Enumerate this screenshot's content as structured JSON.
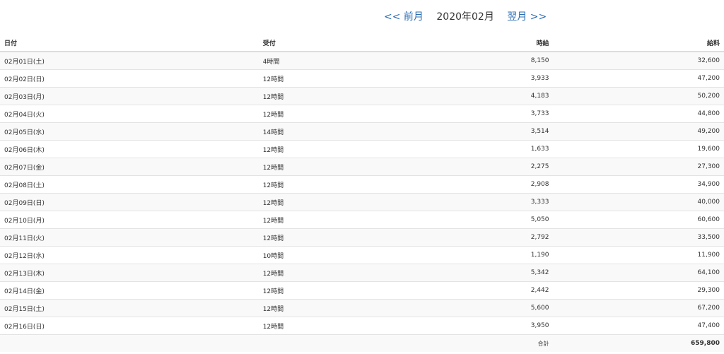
{
  "nav": {
    "prev_label": "<< 前月",
    "current_month": "2020年02月",
    "next_label": "翌月 >>"
  },
  "table": {
    "headers": {
      "date": "日付",
      "reception": "受付",
      "hourly": "時給",
      "pay": "給料"
    },
    "rows": [
      {
        "date": "02月01日(土)",
        "reception": "4時間",
        "hourly": "8,150",
        "pay": "32,600"
      },
      {
        "date": "02月02日(日)",
        "reception": "12時間",
        "hourly": "3,933",
        "pay": "47,200"
      },
      {
        "date": "02月03日(月)",
        "reception": "12時間",
        "hourly": "4,183",
        "pay": "50,200"
      },
      {
        "date": "02月04日(火)",
        "reception": "12時間",
        "hourly": "3,733",
        "pay": "44,800"
      },
      {
        "date": "02月05日(水)",
        "reception": "14時間",
        "hourly": "3,514",
        "pay": "49,200"
      },
      {
        "date": "02月06日(木)",
        "reception": "12時間",
        "hourly": "1,633",
        "pay": "19,600"
      },
      {
        "date": "02月07日(金)",
        "reception": "12時間",
        "hourly": "2,275",
        "pay": "27,300"
      },
      {
        "date": "02月08日(土)",
        "reception": "12時間",
        "hourly": "2,908",
        "pay": "34,900"
      },
      {
        "date": "02月09日(日)",
        "reception": "12時間",
        "hourly": "3,333",
        "pay": "40,000"
      },
      {
        "date": "02月10日(月)",
        "reception": "12時間",
        "hourly": "5,050",
        "pay": "60,600"
      },
      {
        "date": "02月11日(火)",
        "reception": "12時間",
        "hourly": "2,792",
        "pay": "33,500"
      },
      {
        "date": "02月12日(水)",
        "reception": "10時間",
        "hourly": "1,190",
        "pay": "11,900"
      },
      {
        "date": "02月13日(木)",
        "reception": "12時間",
        "hourly": "5,342",
        "pay": "64,100"
      },
      {
        "date": "02月14日(金)",
        "reception": "12時間",
        "hourly": "2,442",
        "pay": "29,300"
      },
      {
        "date": "02月15日(土)",
        "reception": "12時間",
        "hourly": "5,600",
        "pay": "67,200"
      },
      {
        "date": "02月16日(日)",
        "reception": "12時間",
        "hourly": "3,950",
        "pay": "47,400"
      }
    ],
    "total_label": "合計",
    "total_value": "659,800"
  }
}
